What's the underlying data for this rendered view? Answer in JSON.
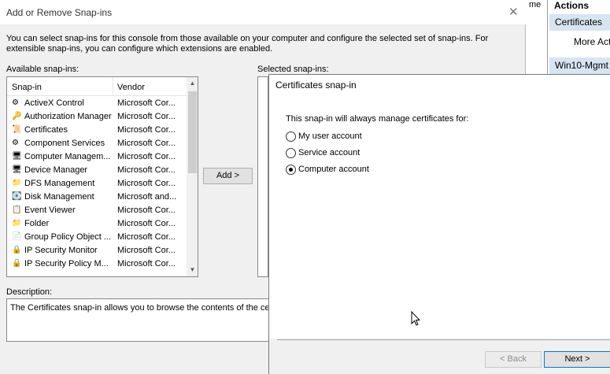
{
  "background_mmc": {
    "column_header_fragment": "me",
    "actions_title": "Actions",
    "actions_items": [
      "Certificates",
      "More Act",
      "Win10-Mgmt"
    ]
  },
  "snapin_dialog": {
    "title": "Add or Remove Snap-ins",
    "intro_text": "You can select snap-ins for this console from those available on your computer and configure the selected set of snap-ins. For extensible snap-ins, you can configure which extensions are enabled.",
    "available_label": "Available snap-ins:",
    "columns": [
      "Snap-in",
      "Vendor"
    ],
    "rows": [
      {
        "name": "ActiveX Control",
        "vendor": "Microsoft Cor...",
        "icon": "activex-icon"
      },
      {
        "name": "Authorization Manager",
        "vendor": "Microsoft Cor...",
        "icon": "authorization-icon"
      },
      {
        "name": "Certificates",
        "vendor": "Microsoft Cor...",
        "icon": "certificates-icon"
      },
      {
        "name": "Component Services",
        "vendor": "Microsoft Cor...",
        "icon": "component-services-icon"
      },
      {
        "name": "Computer Managem...",
        "vendor": "Microsoft Cor...",
        "icon": "computer-management-icon"
      },
      {
        "name": "Device Manager",
        "vendor": "Microsoft Cor...",
        "icon": "device-manager-icon"
      },
      {
        "name": "DFS Management",
        "vendor": "Microsoft Cor...",
        "icon": "folder-icon"
      },
      {
        "name": "Disk Management",
        "vendor": "Microsoft and...",
        "icon": "disk-icon"
      },
      {
        "name": "Event Viewer",
        "vendor": "Microsoft Cor...",
        "icon": "event-viewer-icon"
      },
      {
        "name": "Folder",
        "vendor": "Microsoft Cor...",
        "icon": "folder-icon"
      },
      {
        "name": "Group Policy Object ...",
        "vendor": "Microsoft Cor...",
        "icon": "group-policy-icon"
      },
      {
        "name": "IP Security Monitor",
        "vendor": "Microsoft Cor...",
        "icon": "ip-security-icon"
      },
      {
        "name": "IP Security Policy M...",
        "vendor": "Microsoft Cor...",
        "icon": "ip-security-icon"
      }
    ],
    "add_button": "Add >",
    "selected_label": "Selected snap-ins:",
    "description_label": "Description:",
    "description_text": "The Certificates snap-in allows you to browse the contents of the ce"
  },
  "cert_dialog": {
    "title": "Certificates snap-in",
    "prompt": "This snap-in will always manage certificates for:",
    "options": [
      {
        "label": "My user account",
        "selected": false
      },
      {
        "label": "Service account",
        "selected": false
      },
      {
        "label": "Computer account",
        "selected": true
      }
    ],
    "back_button": "< Back",
    "next_button": "Next >"
  },
  "colors": {
    "selection_blue": "#d7e4f2",
    "default_button_border": "#0078d7"
  }
}
